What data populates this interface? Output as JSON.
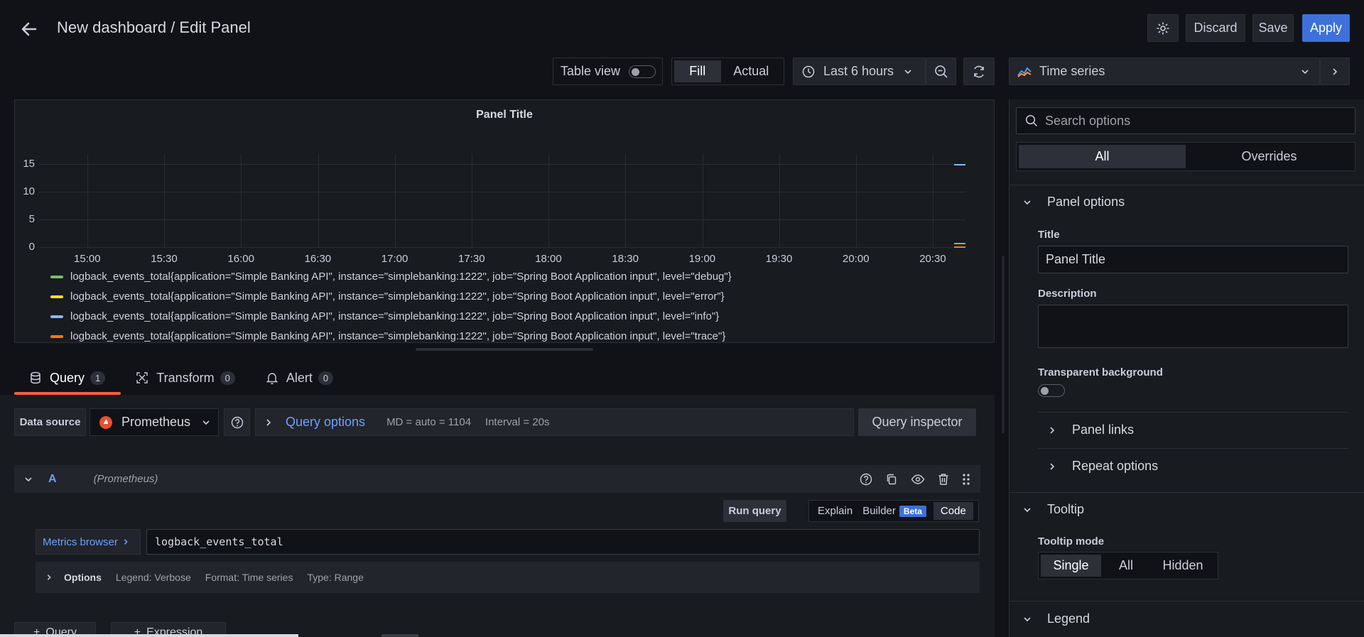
{
  "header": {
    "title": "New dashboard / Edit Panel",
    "discard": "Discard",
    "save": "Save",
    "apply": "Apply"
  },
  "toolbar": {
    "table_view": "Table view",
    "fill": "Fill",
    "actual": "Actual",
    "time_range": "Last 6 hours",
    "visualization": "Time series"
  },
  "chart_data": {
    "type": "line",
    "title": "Panel Title",
    "x": [
      "15:00",
      "15:30",
      "16:00",
      "16:30",
      "17:00",
      "17:30",
      "18:00",
      "18:30",
      "19:00",
      "19:30",
      "20:00",
      "20:30"
    ],
    "y_ticks": [
      "15",
      "10",
      "5",
      "0"
    ],
    "ylim": [
      0,
      15
    ],
    "grid": true,
    "legend_placement": "bottom",
    "series": [
      {
        "name": "logback_events_total{application=\"Simple Banking API\", instance=\"simplebanking:1222\", job=\"Spring Boot Application input\", level=\"debug\"}",
        "color": "#73bf69"
      },
      {
        "name": "logback_events_total{application=\"Simple Banking API\", instance=\"simplebanking:1222\", job=\"Spring Boot Application input\", level=\"error\"}",
        "color": "#fade2a"
      },
      {
        "name": "logback_events_total{application=\"Simple Banking API\", instance=\"simplebanking:1222\", job=\"Spring Boot Application input\", level=\"info\"}",
        "color": "#8ab8ff"
      },
      {
        "name": "logback_events_total{application=\"Simple Banking API\", instance=\"simplebanking:1222\", job=\"Spring Boot Application input\", level=\"trace\"}",
        "color": "#ff780a"
      }
    ]
  },
  "query_tabs": [
    {
      "label": "Query",
      "count": "1"
    },
    {
      "label": "Transform",
      "count": "0"
    },
    {
      "label": "Alert",
      "count": "0"
    }
  ],
  "query": {
    "datasource_label": "Data source",
    "datasource": "Prometheus",
    "query_options": "Query options",
    "md": "MD = auto = 1104",
    "interval": "Interval = 20s",
    "inspector": "Query inspector",
    "ref_id": "A",
    "ref_ds": "(Prometheus)",
    "run_query": "Run query",
    "explain": "Explain",
    "builder": "Builder",
    "beta": "Beta",
    "code": "Code",
    "metrics_browser": "Metrics browser",
    "expression": "logback_events_total",
    "options": "Options",
    "legend": "Legend: Verbose",
    "format": "Format: Time series",
    "qtype": "Type: Range",
    "add_query": "Query",
    "add_expression": "Expression"
  },
  "options_pane": {
    "search_placeholder": "Search options",
    "tab_all": "All",
    "tab_overrides": "Overrides",
    "panel_options": "Panel options",
    "title_label": "Title",
    "title_value": "Panel Title",
    "description_label": "Description",
    "transparent_label": "Transparent background",
    "panel_links": "Panel links",
    "repeat_options": "Repeat options",
    "tooltip": "Tooltip",
    "tooltip_mode": "Tooltip mode",
    "mode_single": "Single",
    "mode_all": "All",
    "mode_hidden": "Hidden",
    "legend": "Legend"
  },
  "colors": {
    "accent": "#3d71d9",
    "link": "#6e9fff",
    "tab_underline": "#f55f3e"
  }
}
